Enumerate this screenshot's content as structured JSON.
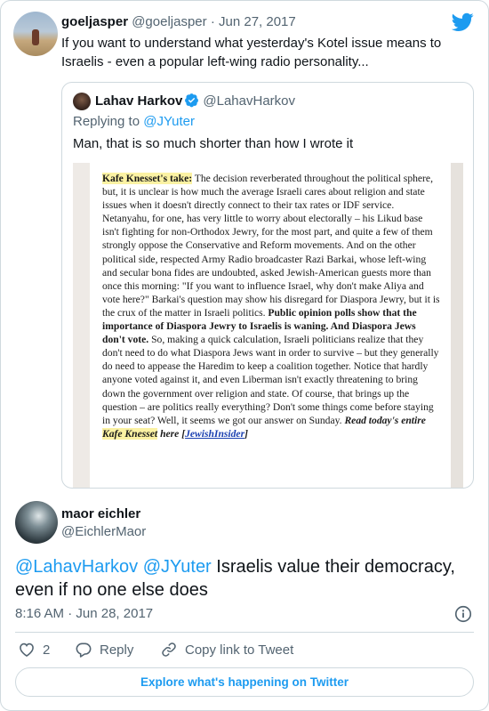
{
  "parent_tweet": {
    "display_name": "goeljasper",
    "handle": "@goeljasper",
    "separator": "·",
    "date": "Jun 27, 2017",
    "text": "If you want to understand what yesterday's Kotel issue means to Israelis - even a popular left-wing radio personality...",
    "platform_icon": "twitter-bird-icon"
  },
  "quoted_tweet": {
    "display_name": "Lahav Harkov",
    "handle": "@LahavHarkov",
    "replying_label": "Replying to",
    "replying_to": "@JYuter",
    "text": "Man, that is so much shorter than how I wrote it",
    "article": {
      "heading": "Kafe Knesset's take:",
      "p1": " The decision reverberated throughout the political sphere, but, it is unclear is how much the average Israeli cares about religion and state issues when it doesn't directly connect to their tax rates or IDF service. Netanyahu, for one, has very little to worry about electorally – his Likud base isn't fighting for non-Orthodox Jewry, for the most part, and quite a few of them strongly oppose the Conservative and Reform movements. And on the other political side, respected Army Radio broadcaster Razi Barkai, whose left-wing and secular bona fides are undoubted, asked Jewish-American guests more than once this morning: \"If you want to influence Israel, why don't make Aliya and vote here?\" Barkai's question may show his disregard for Diaspora Jewry, but it is the crux of the matter in Israeli politics. ",
      "bold_sentence": "Public opinion polls show that the importance of Diaspora Jewry to Israelis is waning. And Diaspora Jews don't vote.",
      "p2": " So, making a quick calculation, Israeli politicians realize that they don't need to do what Diaspora Jews want in order to survive – but they generally do need to appease the Haredim to keep a coalition together. Notice that hardly anyone voted against it, and even Liberman isn't exactly threatening to bring down the government over religion and state. Of course, that brings up the question – are politics really everything? Don't some things come before staying in your seat? Well, it seems we got our answer on Sunday. ",
      "cta_prefix": "Read today's entire ",
      "cta_highlight": "Kafe Knesset",
      "cta_suffix_1": "here [",
      "cta_link": "JewishInsider",
      "cta_suffix_2": "]"
    }
  },
  "reply_tweet": {
    "display_name": "maor eichler",
    "handle": "@EichlerMaor",
    "mention_1": "@LahavHarkov",
    "mention_2": "@JYuter",
    "text": " Israelis value their democracy, even if no one else does",
    "time": "8:16 AM",
    "separator": "·",
    "date": "Jun 28, 2017"
  },
  "actions": {
    "like_count": "2",
    "reply_label": "Reply",
    "copy_label": "Copy link to Tweet"
  },
  "explore_button": "Explore what's happening on Twitter",
  "colors": {
    "accent": "#1d9bf0",
    "text": "#0f1419",
    "muted": "#536471",
    "border": "#cfd9de",
    "highlight": "#fbf2a3"
  }
}
